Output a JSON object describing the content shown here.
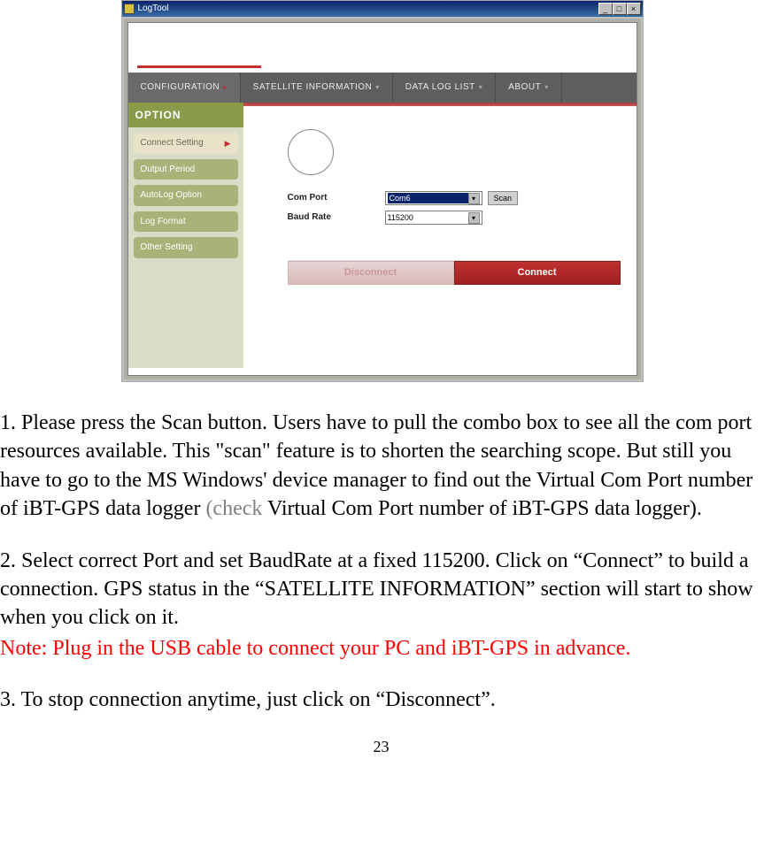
{
  "window": {
    "title": "LogTool"
  },
  "tabs": {
    "configuration": "CONFIGURATION",
    "satellite": "SATELLITE  INFORMATION",
    "datalog": "DATA  LOG  LIST",
    "about": "ABOUT"
  },
  "sidebar": {
    "header": "OPTION",
    "items": [
      {
        "label": "Connect  Setting"
      },
      {
        "label": "Output  Period"
      },
      {
        "label": "AutoLog  Option"
      },
      {
        "label": "Log  Format"
      },
      {
        "label": "Other  Setting"
      }
    ]
  },
  "form": {
    "comport_label": "Com Port",
    "comport_value": "Com6",
    "baud_label": "Baud Rate",
    "baud_value": "115200",
    "scan_btn": "Scan",
    "disconnect_btn": "Disconnect",
    "connect_btn": "Connect"
  },
  "doc": {
    "p1a": "1. Please press the Scan button. Users have to pull the combo box to see all the com port resources available. This \"scan\" feature is to shorten the searching scope. But still you have to go to the MS Windows' device manager to find out the Virtual Com Port number of iBT-GPS data logger ",
    "p1b_gray": "(check",
    "p1c": " Virtual Com Port number of iBT-GPS data logger).",
    "p2": "2. Select correct Port and set BaudRate at a fixed 115200. Click on “Connect” to build a connection. GPS status in the “SATELLITE INFORMATION” section will start to show when you click on it.",
    "note": "Note: Plug in the USB cable to connect your PC and iBT-GPS in advance.",
    "p3": "3. To stop connection anytime, just click on “Disconnect”.",
    "page": "23"
  }
}
